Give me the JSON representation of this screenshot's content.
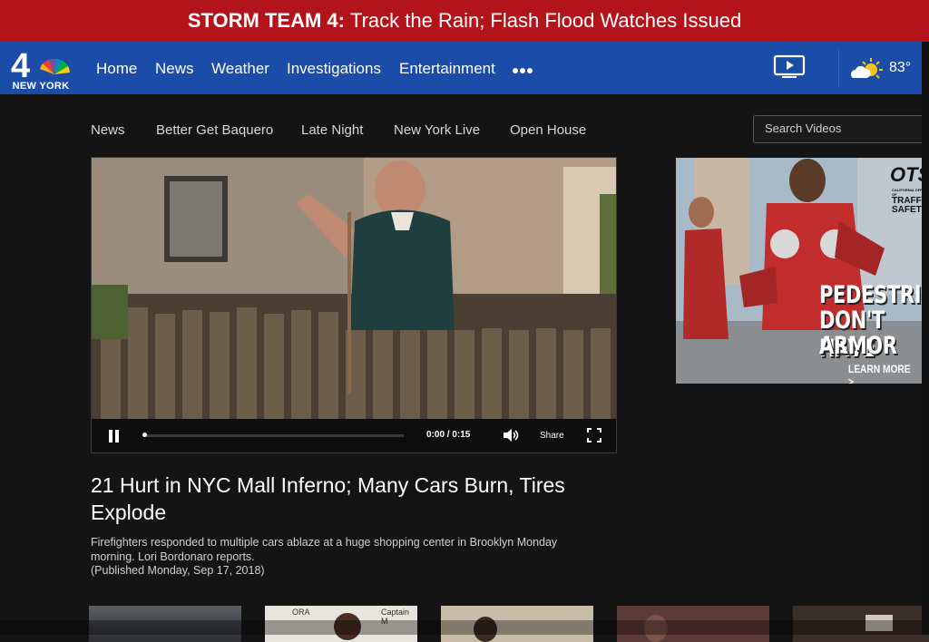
{
  "alert": {
    "prefix": "STORM TEAM 4:",
    "text": "Track the Rain; Flash Flood Watches Issued"
  },
  "brand": {
    "logo_text": "NEW YORK",
    "logo_numeral": "4"
  },
  "nav": {
    "items": [
      "Home",
      "News",
      "Weather",
      "Investigations",
      "Entertainment"
    ],
    "more_icon": "ellipsis-icon",
    "tv_icon": "tv-play-icon"
  },
  "weather": {
    "temperature": "83°",
    "icon": "partly-sunny-icon"
  },
  "subnav": {
    "items": [
      "News",
      "Better Get Baquero",
      "Late Night",
      "New York Live",
      "Open House"
    ]
  },
  "search": {
    "placeholder": "Search Videos",
    "value": ""
  },
  "video": {
    "time": "0:00 / 0:15",
    "share_label": "Share",
    "progress": 0.0
  },
  "article": {
    "headline": "21 Hurt in NYC Mall Inferno; Many Cars Burn, Tires Explode",
    "summary": "Firefighters responded to multiple cars ablaze at a huge shopping center in Brooklyn Monday morning. Lori Bordonaro reports.",
    "published": "(Published Monday, Sep 17, 2018)"
  },
  "ad": {
    "brand": "OTS",
    "brand_sub_1": "CALIFORNIA OFFICE OF",
    "brand_sub_2": "TRAFFIC",
    "brand_sub_3": "SAFETY",
    "line1": "PEDESTRIANS",
    "line2": "DON'T HAVE",
    "line3": "ARMOR",
    "cta": "LEARN MORE >"
  },
  "thumbnails": {
    "thumb2_label": "ORA",
    "thumb2_label2": "Captain M"
  },
  "colors": {
    "alert": "#b3141b",
    "nav": "#1a4ca8",
    "background": "#141414"
  }
}
